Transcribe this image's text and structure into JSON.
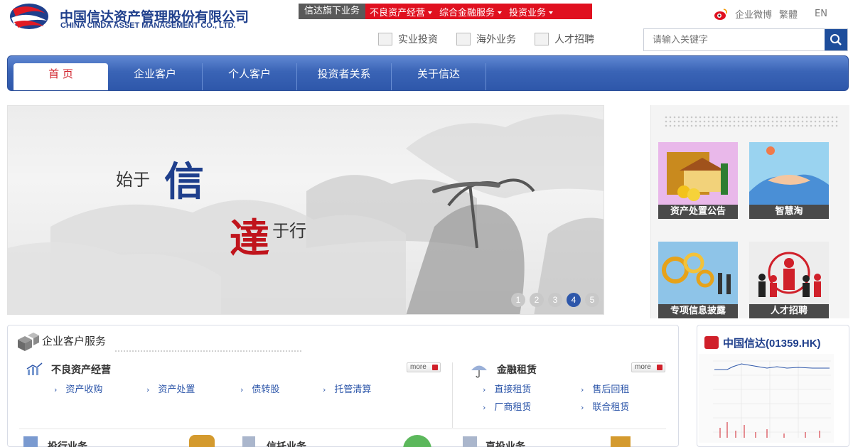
{
  "header": {
    "logo_cn": "中国信达资产管理股份有限公司",
    "logo_en": "CHINA CINDA ASSET MANAGEMENT CO., LTD.",
    "biz_label": "信达旗下业务",
    "biz_items": [
      "不良资产经营",
      "综合金融服务",
      "投资业务"
    ],
    "top_links": {
      "weibo": "企业微博",
      "traditional": "繁體",
      "english": "EN"
    },
    "sub_links": [
      "实业投资",
      "海外业务",
      "人才招聘"
    ],
    "search_placeholder": "请输入关键字"
  },
  "nav": {
    "items": [
      "首 页",
      "企业客户",
      "个人客户",
      "投资者关系",
      "关于信达"
    ],
    "active_index": 0
  },
  "banner": {
    "slogan_lead": "始于",
    "slogan_big1": "信",
    "slogan_big2": "達",
    "slogan_tail": "于行",
    "pages": [
      "1",
      "2",
      "3",
      "4",
      "5"
    ],
    "active_page": 4
  },
  "tiles": [
    {
      "label": "资产处置公告"
    },
    {
      "label": "智慧淘"
    },
    {
      "label": "专项信息披露"
    },
    {
      "label": "人才招聘"
    }
  ],
  "services": {
    "title": "企业客户服务",
    "more_label": "more",
    "npl": {
      "title": "不良资产经营",
      "links": [
        "资产收购",
        "资产处置",
        "债转股",
        "托管清算"
      ]
    },
    "leasing": {
      "title": "金融租赁",
      "links": [
        "直接租赁",
        "售后回租",
        "厂商租赁",
        "联合租赁"
      ]
    },
    "bottom_row": [
      "投行业务",
      "信托业务",
      "直投业务"
    ]
  },
  "stock": {
    "title": "中国信达(01359.HK)"
  },
  "colors": {
    "brand_blue": "#1f3f8c",
    "nav_blue": "#3a64b6",
    "accent_red": "#e0101f"
  }
}
